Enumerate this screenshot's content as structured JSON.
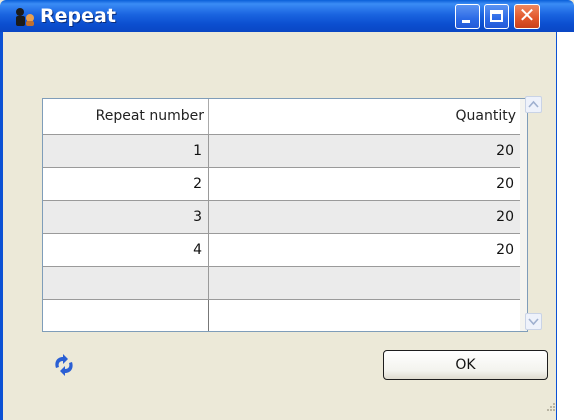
{
  "window": {
    "title": "Repeat"
  },
  "titlebar_buttons": {
    "close_glyph": "✕"
  },
  "grid": {
    "columns": [
      "Repeat number",
      "Quantity"
    ],
    "rows": [
      {
        "repeat": "1",
        "quantity": "20"
      },
      {
        "repeat": "2",
        "quantity": "20"
      },
      {
        "repeat": "3",
        "quantity": "20"
      },
      {
        "repeat": "4",
        "quantity": "20"
      },
      {
        "repeat": "",
        "quantity": ""
      },
      {
        "repeat": "",
        "quantity": ""
      }
    ]
  },
  "footer": {
    "ok_label": "OK",
    "refresh_icon": "refresh-icon"
  },
  "colors": {
    "titlebar": "#0b51d4",
    "close_button": "#e2582c",
    "window_bg": "#ece9d8",
    "alt_row": "#ebebeb"
  }
}
